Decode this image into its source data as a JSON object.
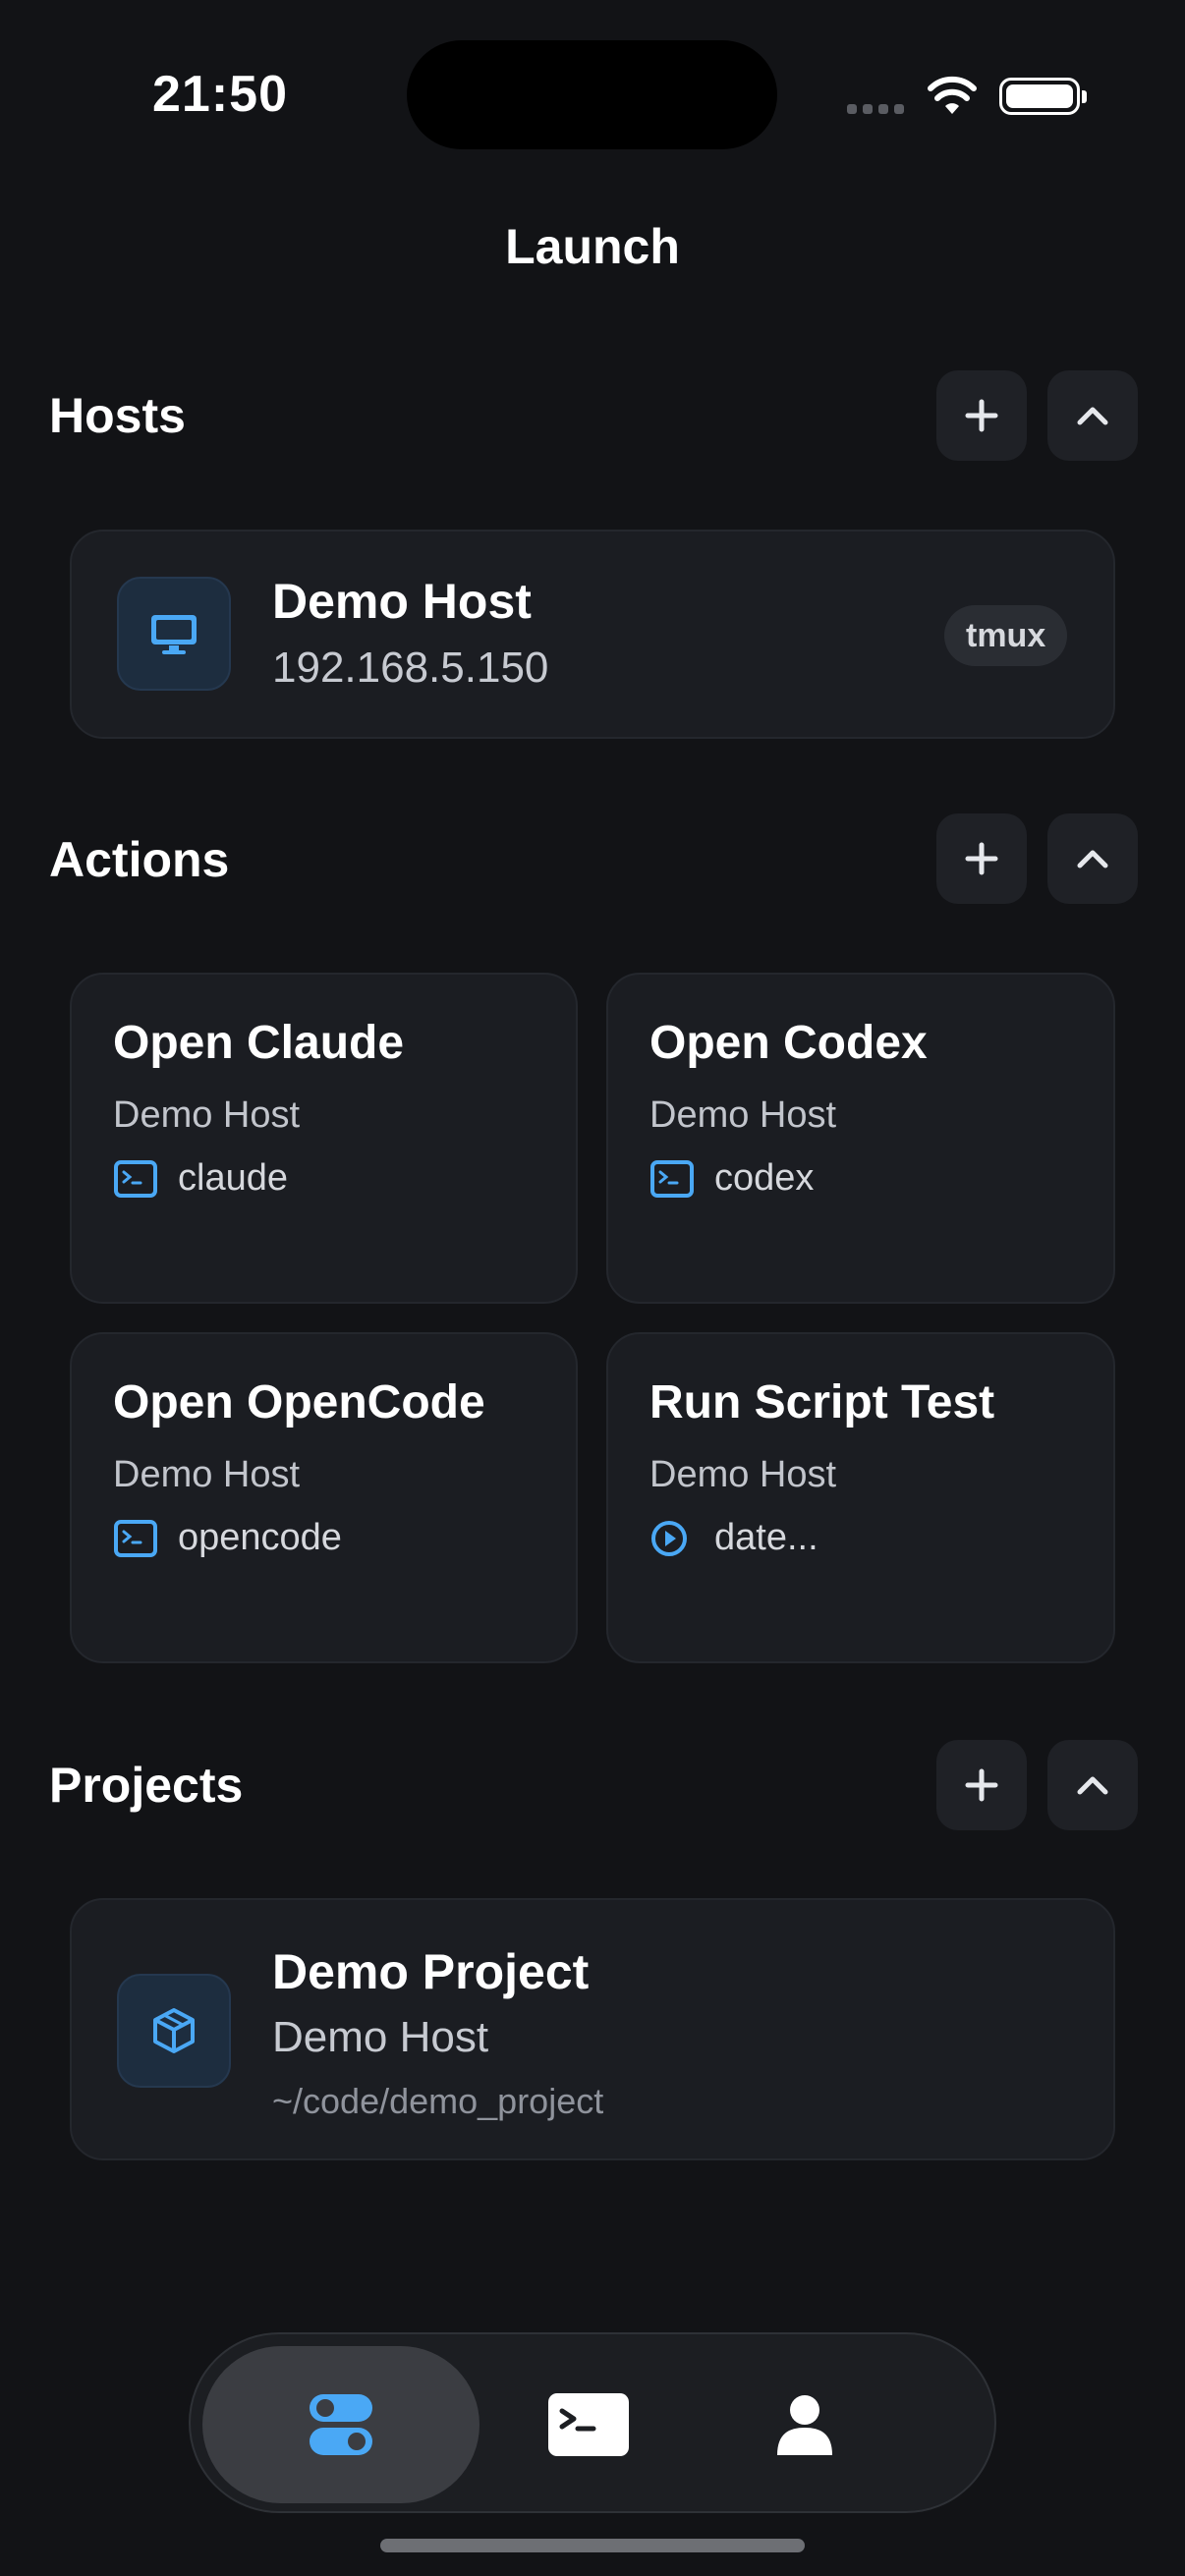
{
  "status_bar": {
    "time": "21:50"
  },
  "nav": {
    "title": "Launch"
  },
  "hosts": {
    "title": "Hosts",
    "items": [
      {
        "name": "Demo Host",
        "address": "192.168.5.150",
        "badge": "tmux",
        "icon": "monitor-icon"
      }
    ]
  },
  "actions": {
    "title": "Actions",
    "items": [
      {
        "title": "Open Claude",
        "host": "Demo Host",
        "command": "claude",
        "icon": "terminal-icon"
      },
      {
        "title": "Open Codex",
        "host": "Demo Host",
        "command": "codex",
        "icon": "terminal-icon"
      },
      {
        "title": "Open OpenCode",
        "host": "Demo Host",
        "command": "opencode",
        "icon": "terminal-icon"
      },
      {
        "title": "Run Script Test",
        "host": "Demo Host",
        "command": "date...",
        "icon": "play-circle-icon"
      }
    ]
  },
  "projects": {
    "title": "Projects",
    "items": [
      {
        "name": "Demo Project",
        "host": "Demo Host",
        "path": "~/code/demo_project",
        "icon": "cube-icon"
      }
    ]
  },
  "tabbar": {
    "tabs": [
      {
        "icon": "toggles-icon",
        "active": true
      },
      {
        "icon": "terminal-icon",
        "active": false
      },
      {
        "icon": "person-icon",
        "active": false
      }
    ]
  },
  "colors": {
    "accent": "#4aa8f5",
    "background": "#121316",
    "card": "#1b1d22"
  }
}
